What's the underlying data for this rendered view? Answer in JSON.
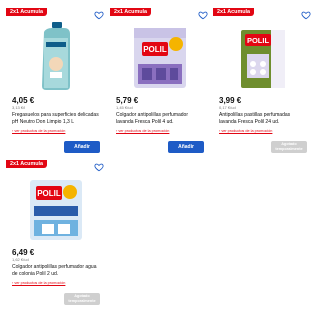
{
  "products": [
    {
      "badge": "2x1 Acumula",
      "price": "4,05 €",
      "unit_price": "3,13 €/l",
      "title": "Fregasuelos para superficies delicadas pH Neutro Don Limpio 1,3 L",
      "promo_link": "› ver productos de la promoción",
      "button": "Añadir",
      "button_state": "enabled",
      "package_text": ""
    },
    {
      "badge": "2x1 Acumula",
      "price": "5,79 €",
      "unit_price": "1,45 €/ud",
      "title": "Colgador antipolillas perfumador lavanda Fresca Polil 4 ud.",
      "promo_link": "› ver productos de la promoción",
      "button": "Añadir",
      "button_state": "enabled",
      "package_text": "POLIL"
    },
    {
      "badge": "2x1 Acumula",
      "price": "3,99 €",
      "unit_price": "0,17 €/ud",
      "title": "Antipolillas pastillas perfumadas lavanda Fresca Polil 24 ud.",
      "promo_link": "› ver productos de la promoción",
      "button": "Agotado temporalmente",
      "button_state": "disabled",
      "package_text": "POLIL"
    },
    {
      "badge": "2x1 Acumula",
      "price": "6,49 €",
      "unit_price": "1,62 €/ud",
      "title": "Colgador antipolillas perfumador agua de colonia Polil 2 ud.",
      "promo_link": "› ver productos de la promoción",
      "button": "Agotado temporalmente",
      "button_state": "disabled",
      "package_text": "POLIL"
    }
  ],
  "colors": {
    "badge": "#e20613",
    "button": "#1e5bc6",
    "button_disabled": "#cfcfcf",
    "heart_outline": "#1e5bc6"
  },
  "icons": {
    "favorite": "heart-outline-icon"
  }
}
